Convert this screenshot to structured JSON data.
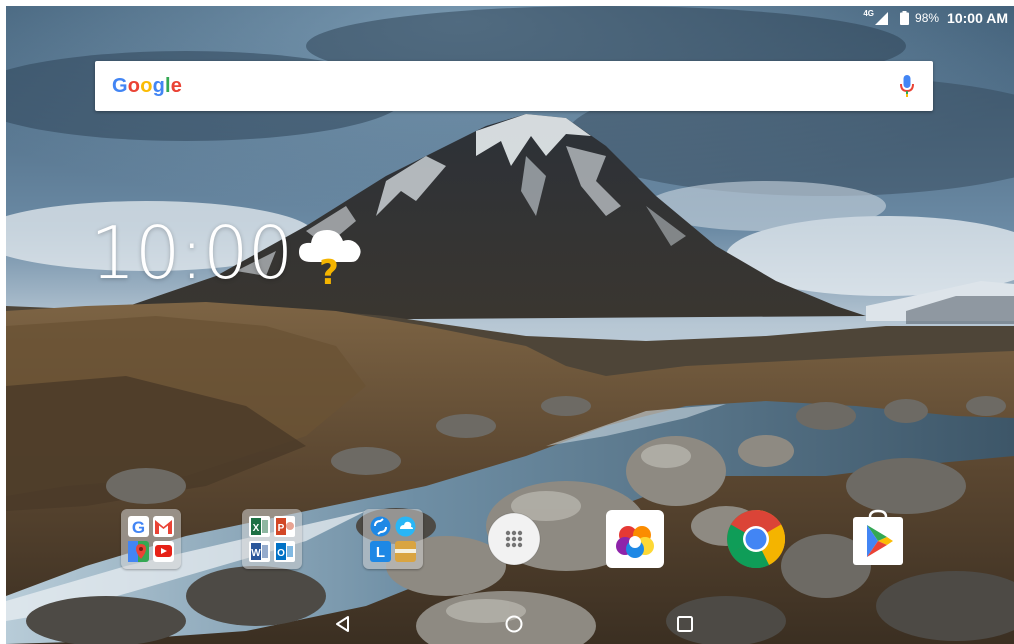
{
  "status_bar": {
    "network": "4G",
    "battery": "98%",
    "time": "10:00 AM"
  },
  "search": {
    "logo_letters": [
      {
        "char": "G",
        "color": "#4285F4"
      },
      {
        "char": "o",
        "color": "#EA4335"
      },
      {
        "char": "o",
        "color": "#FBBC05"
      },
      {
        "char": "g",
        "color": "#4285F4"
      },
      {
        "char": "l",
        "color": "#34A853"
      },
      {
        "char": "e",
        "color": "#EA4335"
      }
    ],
    "mic_icon": "microphone-icon"
  },
  "clock_widget": {
    "time": "10:00",
    "weather_icon": "cloud-unknown-weather-icon"
  },
  "dock": {
    "items": [
      {
        "icon": "google-apps-folder-icon"
      },
      {
        "icon": "office-apps-folder-icon"
      },
      {
        "icon": "lenovo-tools-folder-icon"
      },
      {
        "icon": "app-drawer-icon"
      },
      {
        "icon": "photos-gallery-icon"
      },
      {
        "icon": "chrome-icon"
      },
      {
        "icon": "play-store-icon"
      }
    ]
  },
  "nav_bar": {
    "back_icon": "back-triangle-icon",
    "home_icon": "home-circle-icon",
    "recents_icon": "recents-square-icon"
  },
  "colors": {
    "office_excel": "#1D7044",
    "office_powerpoint": "#D24726",
    "office_word": "#2B579A",
    "office_outlook": "#0072C6",
    "chrome_red": "#DB4437",
    "chrome_yellow": "#F4B400",
    "chrome_green": "#0F9D58",
    "chrome_blue": "#4285F4"
  }
}
